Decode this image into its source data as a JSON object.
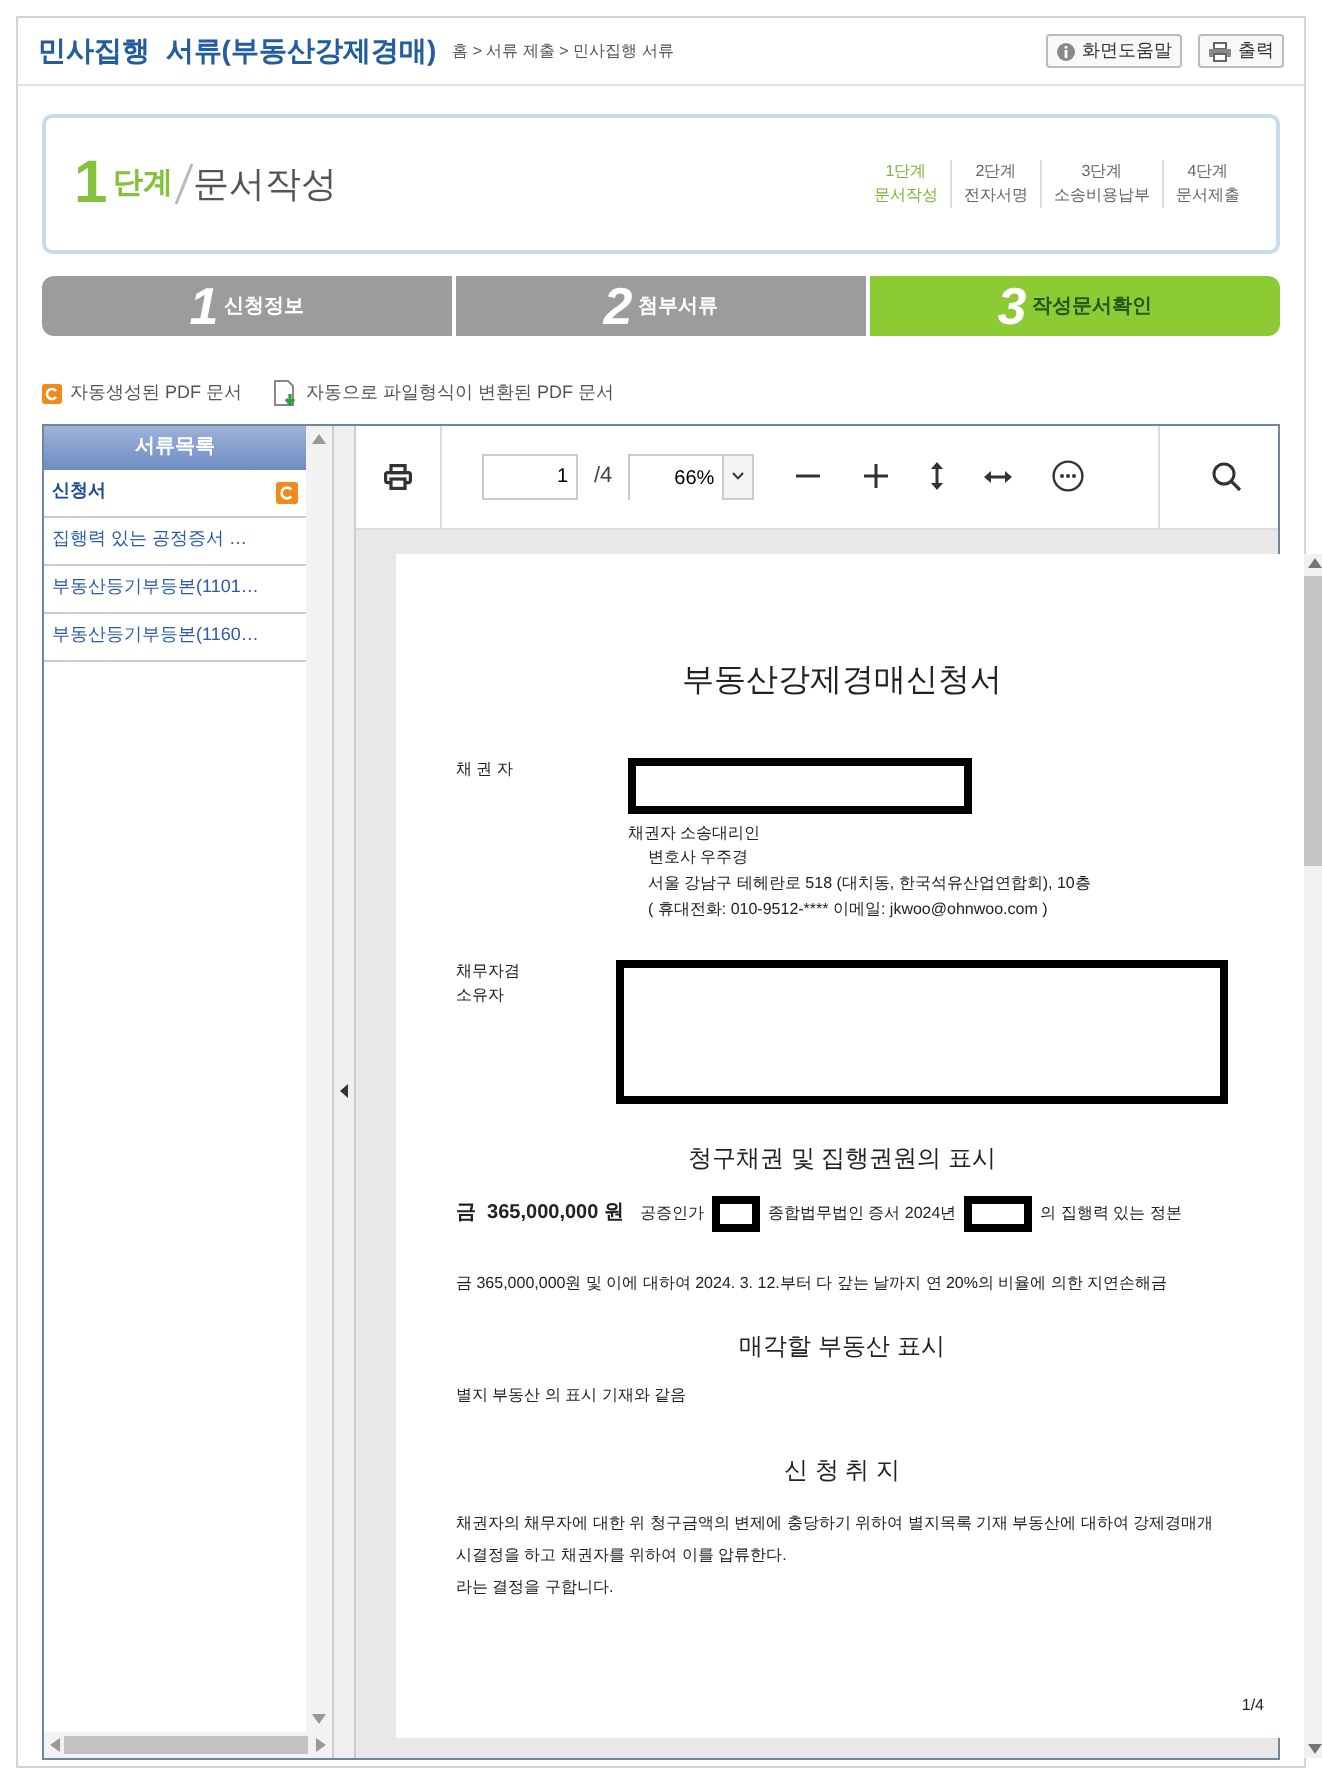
{
  "header": {
    "title": "민사집행  서류(부동산강제경매)",
    "breadcrumb": "홈 > 서류 제출 > 민사집행 서류",
    "buttons": [
      {
        "kind": "help",
        "label": "화면도움말"
      },
      {
        "kind": "print",
        "label": "출력"
      }
    ]
  },
  "stage": {
    "number": "1",
    "unit": "단계",
    "title": "문서작성",
    "steps": [
      {
        "step": "1단계",
        "name": "문서작성",
        "selected": true
      },
      {
        "step": "2단계",
        "name": "전자서명",
        "selected": false
      },
      {
        "step": "3단계",
        "name": "소송비용납부",
        "selected": false
      },
      {
        "step": "4단계",
        "name": "문서제출",
        "selected": false
      }
    ]
  },
  "tabs": [
    {
      "number": "1",
      "label": "신청정보",
      "selected": false
    },
    {
      "number": "2",
      "label": "첨부서류",
      "selected": false
    },
    {
      "number": "3",
      "label": "작성문서확인",
      "selected": true
    }
  ],
  "legend": [
    {
      "kind": "auto",
      "text": "자동생성된 PDF 문서"
    },
    {
      "kind": "converted",
      "text": "자동으로 파일형식이 변환된 PDF 문서"
    }
  ],
  "doc_list": {
    "title": "서류목록",
    "items": [
      {
        "label": "신청서",
        "selected": true,
        "kind": "auto"
      },
      {
        "label": "집행력 있는 공정증서 …",
        "selected": false,
        "kind": "plain"
      },
      {
        "label": "부동산등기부등본(1101…",
        "selected": false,
        "kind": "plain"
      },
      {
        "label": "부동산등기부등본(1160…",
        "selected": false,
        "kind": "plain"
      }
    ]
  },
  "viewer": {
    "page": "1",
    "total": "/4",
    "zoom": "66%"
  },
  "document": {
    "title": "부동산강제경매신청서",
    "creditor_label": "채 권 자",
    "agent_lines": [
      "채권자 소송대리인",
      "변호사 우주경",
      "서울 강남구 테헤란로 518 (대치동, 한국석유산업연합회), 10층",
      "(  휴대전화: 010-9512-****    이메일: jkwoo@ohnwoo.com )"
    ],
    "debtor_label": [
      "채무자겸",
      "소유자"
    ],
    "claim_heading": "청구채권 및 집행권원의 표시",
    "claim_line": [
      {
        "kind": "bold",
        "text": "금  365,000,000 원"
      },
      {
        "kind": "text",
        "text": "공증인가"
      },
      {
        "kind": "redacted"
      },
      {
        "kind": "text",
        "text": "종합법무법인 증서 2024년"
      },
      {
        "kind": "redacted"
      },
      {
        "kind": "text",
        "text": "의 집행력 있는 정본"
      }
    ],
    "claim_detail": "금 365,000,000원 및 이에 대하여 2024. 3. 12.부터 다 갚는 날까지 연 20%의 비율에 의한 지연손해금",
    "property_heading": "매각할 부동산 표시",
    "property_text": "별지 부동산 의 표시 기재와 같음",
    "purpose_heading": "신 청 취 지",
    "purpose_lines": [
      "채권자의 채무자에 대한 위 청구금액의 변제에 충당하기 위하여 별지목록 기재 부동산에 대하여 강제경매개시결정을 하고 채권자를 위하여 이를 압류한다.",
      "라는 결정을 구합니다."
    ],
    "page_footer": "1/4"
  }
}
